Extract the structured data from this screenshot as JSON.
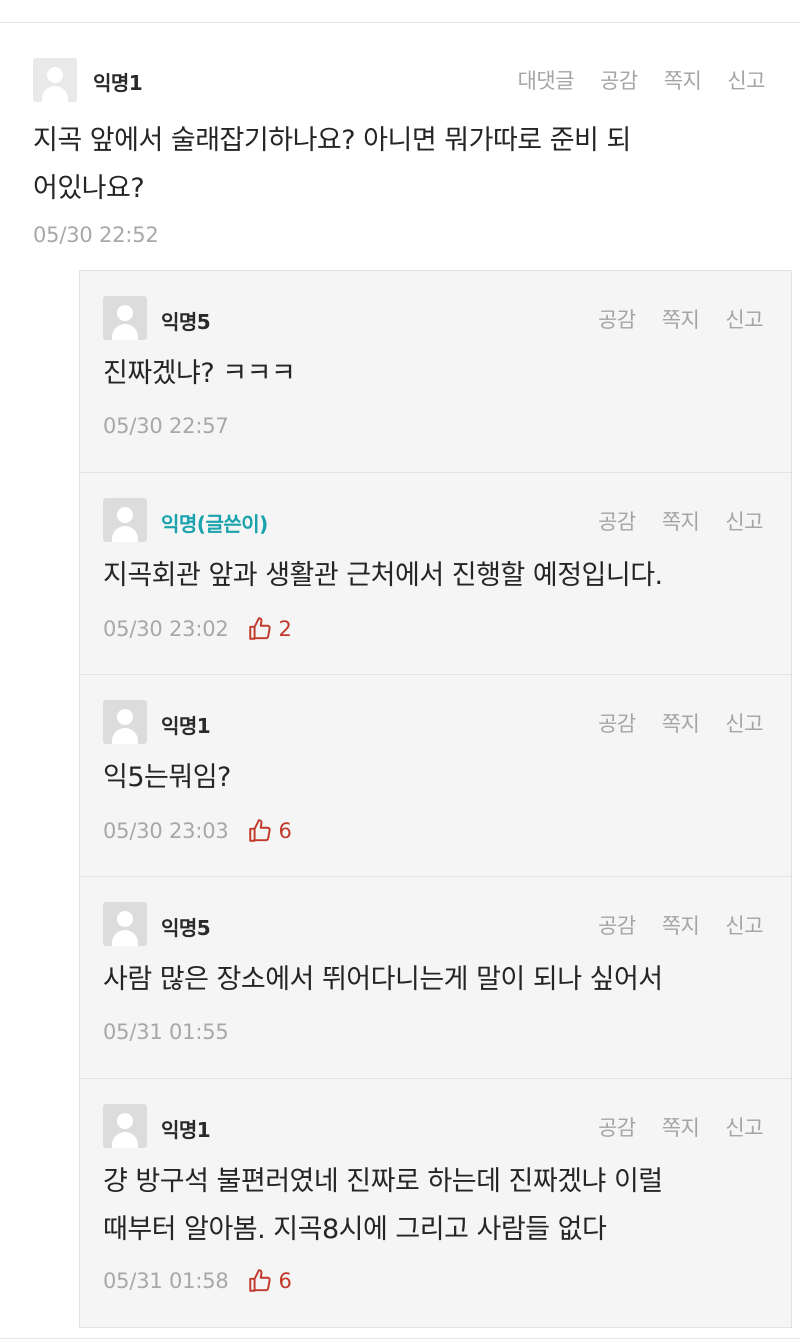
{
  "main_comment": {
    "author": "익명1",
    "actions": [
      "대댓글",
      "공감",
      "쪽지",
      "신고"
    ],
    "content_lines": [
      "지곡 앞에서 술래잡기하나요? 아니면 뭐가따로 준비 되",
      "어있나요?"
    ],
    "time": "05/30 22:52"
  },
  "replies": [
    {
      "author": "익명5",
      "is_op": false,
      "actions": [
        "공감",
        "쪽지",
        "신고"
      ],
      "content_lines": [
        "진짜겠냐? ㅋㅋㅋ"
      ],
      "time": "05/30 22:57",
      "likes": ""
    },
    {
      "author": "익명(글쓴이)",
      "is_op": true,
      "actions": [
        "공감",
        "쪽지",
        "신고"
      ],
      "content_lines": [
        "지곡회관 앞과 생활관 근처에서 진행할 예정입니다."
      ],
      "time": "05/30 23:02",
      "likes": "2"
    },
    {
      "author": "익명1",
      "is_op": false,
      "actions": [
        "공감",
        "쪽지",
        "신고"
      ],
      "content_lines": [
        "익5는뭐임?"
      ],
      "time": "05/30 23:03",
      "likes": "6"
    },
    {
      "author": "익명5",
      "is_op": false,
      "actions": [
        "공감",
        "쪽지",
        "신고"
      ],
      "content_lines": [
        "사람 많은 장소에서 뛰어다니는게 말이 되나 싶어서"
      ],
      "time": "05/31 01:55",
      "likes": ""
    },
    {
      "author": "익명1",
      "is_op": false,
      "actions": [
        "공감",
        "쪽지",
        "신고"
      ],
      "content_lines": [
        "걍 방구석 불편러였네 진짜로 하는데 진짜겠냐 이럴",
        "때부터 알아봄. 지곡8시에 그리고 사람들 없다"
      ],
      "time": "05/31 01:58",
      "likes": "6"
    }
  ],
  "icons": {
    "avatar": "user-avatar-icon",
    "like": "thumbs-up-icon"
  },
  "colors": {
    "op_author": "#1aa3ad",
    "like": "#c0392b",
    "muted": "#a8a8a8"
  }
}
